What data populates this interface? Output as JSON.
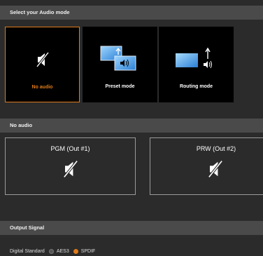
{
  "audio_mode": {
    "header": "Select your Audio mode",
    "modes": [
      {
        "label": "No audio",
        "icon": "mute-speaker-icon",
        "selected": true
      },
      {
        "label": "Preset mode",
        "icon": "preset-screens-icon",
        "selected": false
      },
      {
        "label": "Routing mode",
        "icon": "routing-screen-icon",
        "selected": false
      }
    ]
  },
  "no_audio": {
    "header": "No audio",
    "outputs": [
      {
        "label": "PGM (Out #1)",
        "icon": "mute-speaker-icon"
      },
      {
        "label": "PRW (Out #2)",
        "icon": "mute-speaker-icon"
      }
    ]
  },
  "output_signal": {
    "header": "Output Signal",
    "digital_standard_label": "Digital Standard",
    "options": [
      {
        "label": "AES3",
        "selected": false
      },
      {
        "label": "SPDIF",
        "selected": true
      }
    ]
  },
  "colors": {
    "accent": "#e07b1a",
    "background": "#2b2b2b",
    "header": "#4a4a4a",
    "card": "#000000"
  }
}
